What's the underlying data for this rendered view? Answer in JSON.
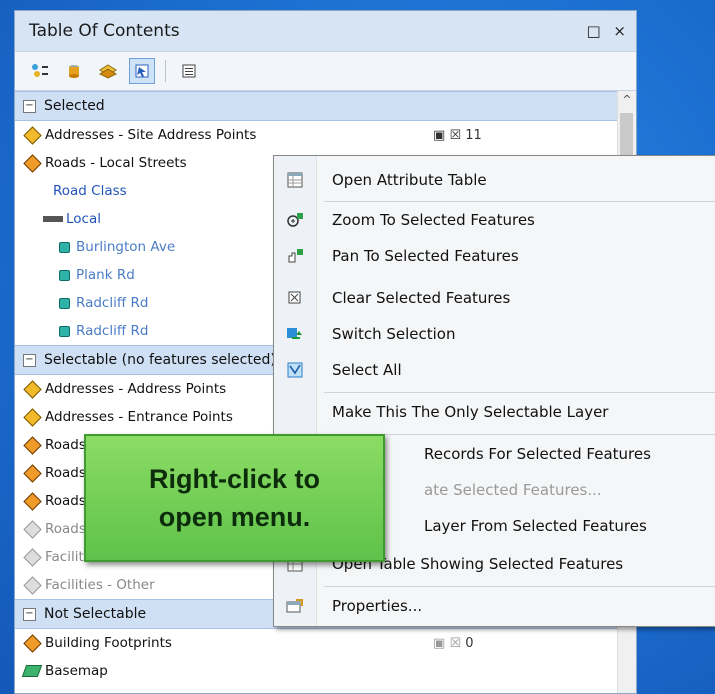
{
  "window": {
    "title": "Table Of Contents",
    "restore_glyph": "□",
    "close_glyph": "×"
  },
  "toolbar": {
    "buttons": [
      "list-by-drawing-order-icon",
      "list-by-source-icon",
      "list-by-visibility-icon",
      "list-by-selection-icon",
      "options-icon"
    ],
    "active": "list-by-selection-icon"
  },
  "groups": {
    "selected": {
      "label": "Selected",
      "toggle": "−"
    },
    "selectable": {
      "label": "Selectable (no features selected)",
      "toggle": "−"
    },
    "not_selectable": {
      "label": "Not Selectable",
      "toggle": "−"
    }
  },
  "rows": {
    "addresses_site": {
      "label": "Addresses - Site Address Points",
      "count": "11"
    },
    "roads_local": {
      "label": "Roads - Local Streets"
    },
    "road_class": {
      "label": "Road Class"
    },
    "local": {
      "label": "Local"
    },
    "features": [
      "Burlington Ave",
      "Plank Rd",
      "Radcliff Rd",
      "Radcliff Rd"
    ],
    "selectable_layers": [
      "Addresses - Address Points",
      "Addresses - Entrance Points",
      "Roads",
      "Roads",
      "Roads",
      "Roads",
      "Facilities - Points",
      "Facilities - Other"
    ],
    "building_footprints": {
      "label": "Building Footprints",
      "count": "0"
    },
    "basemap": {
      "label": "Basemap"
    }
  },
  "context_menu": {
    "items": [
      {
        "label": "Open Attribute Table",
        "icon": "table-icon"
      },
      {
        "label": "Zoom To Selected Features",
        "icon": "zoom-to-selected-icon"
      },
      {
        "label": "Pan To Selected Features",
        "icon": "pan-to-selected-icon"
      },
      {
        "label": "Clear Selected Features",
        "icon": "clear-selection-icon"
      },
      {
        "label": "Switch Selection",
        "icon": "switch-selection-icon"
      },
      {
        "label": "Select All",
        "icon": "select-all-icon"
      },
      {
        "label": "Make This The Only Selectable Layer",
        "icon": ""
      },
      {
        "label": "Records For Selected Features",
        "icon": ""
      },
      {
        "label": "ate Selected Features...",
        "icon": "",
        "disabled": true
      },
      {
        "label": "Layer From Selected Features",
        "icon": ""
      },
      {
        "label": "Open Table Showing Selected Features",
        "icon": "table-icon"
      },
      {
        "label": "Properties...",
        "icon": "properties-icon"
      }
    ]
  },
  "callout": {
    "line1": "Right-click to",
    "line2": "open menu."
  }
}
